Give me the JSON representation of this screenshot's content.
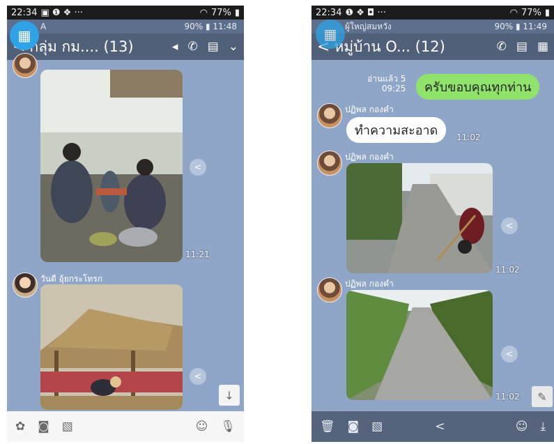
{
  "left": {
    "status": {
      "time": "22:34",
      "notif_icons": "▣ ❶ ❖ ···",
      "signal": "77%"
    },
    "overlay": {
      "label": "A",
      "right": "90% ▮ 11:48"
    },
    "header": {
      "back": "<",
      "title": "กลุ่ม กม.... (13)"
    },
    "messages": {
      "photo1_time": "11:21",
      "sender2": "วันดี อุ้ยกระโทรก"
    },
    "bottom": {
      "down": "↓"
    }
  },
  "right": {
    "status": {
      "time": "22:34",
      "notif_icons": "❶ ❖ ◘ ···",
      "signal": "77%"
    },
    "overlay": {
      "label": "ผู้ใหญ่สมหวัง",
      "right": "90% ▮ 11:49"
    },
    "header": {
      "back": "<",
      "title": "หมู่บ้าน O... (12)"
    },
    "messages": {
      "read_label": "อ่านแล้ว 5",
      "read_time": "09:25",
      "my_text": "ครับขอบคุณทุกท่าน",
      "sender": "ปฏิพล กองคำ",
      "text1": "ทำความสะอาด",
      "text1_time": "11:02",
      "photo1_time": "11:02",
      "photo2_time": "11:02"
    }
  },
  "colors": {
    "chat_bg": "#8fa6c8",
    "header": "#506079",
    "my_bubble": "#90e36a",
    "fab": "#2fa3e6"
  }
}
